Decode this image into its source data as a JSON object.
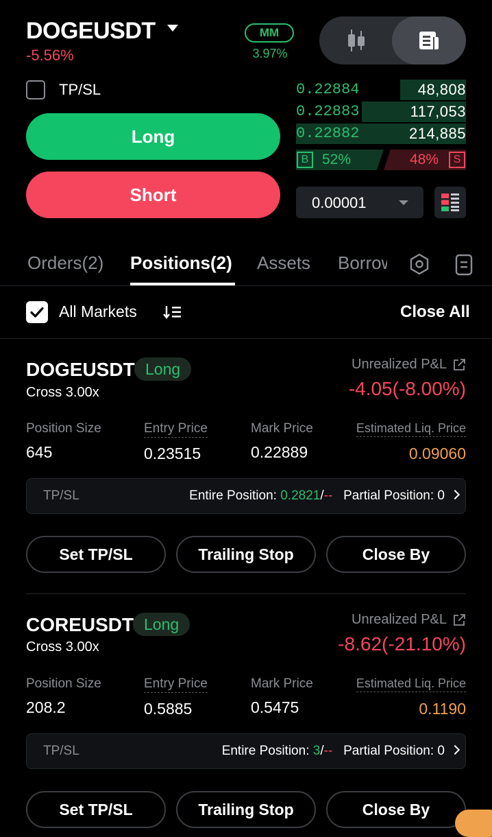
{
  "header": {
    "pair": "DOGEUSDT",
    "change_pct": "-5.56%",
    "mm_label": "MM",
    "mm_value": "3.97%"
  },
  "order_form": {
    "tpsl_label": "TP/SL",
    "long_label": "Long",
    "short_label": "Short"
  },
  "order_book": {
    "rows": [
      {
        "price": "0.22884",
        "qty": "48,808"
      },
      {
        "price": "0.22883",
        "qty": "117,053"
      },
      {
        "price": "0.22882",
        "qty": "214,885"
      }
    ],
    "buy_tag": "B",
    "buy_pct": "52%",
    "sell_pct": "48%",
    "sell_tag": "S",
    "tick_size": "0.00001"
  },
  "tabs": [
    {
      "label": "Orders(2)"
    },
    {
      "label": "Positions(2)"
    },
    {
      "label": "Assets"
    },
    {
      "label": "Borrow"
    }
  ],
  "filter": {
    "all_markets": "All Markets",
    "close_all": "Close All"
  },
  "labels": {
    "unrealized_pnl": "Unrealized P&L",
    "position_size": "Position Size",
    "entry_price": "Entry Price",
    "mark_price": "Mark Price",
    "est_liq_price": "Estimated Liq. Price",
    "tpsl": "TP/SL",
    "entire_position": "Entire Position:",
    "partial_position": "Partial Position:",
    "set_tpsl": "Set TP/SL",
    "trailing_stop": "Trailing Stop",
    "close_by": "Close By",
    "slash": "/",
    "dashes": "--"
  },
  "positions": [
    {
      "symbol": "DOGEUSDT",
      "side": "Long",
      "margin_mode": "Cross 3.00x",
      "pnl": "-4.05(-8.00%)",
      "size": "645",
      "entry": "0.23515",
      "mark": "0.22889",
      "liq": "0.09060",
      "tp": "0.2821",
      "partial_count": "0"
    },
    {
      "symbol": "COREUSDT",
      "side": "Long",
      "margin_mode": "Cross 3.00x",
      "pnl": "-8.62(-21.10%)",
      "size": "208.2",
      "entry": "0.5885",
      "mark": "0.5475",
      "liq": "0.1190",
      "tp": "3",
      "partial_count": "0"
    }
  ],
  "colors": {
    "green": "#2ebd6f",
    "red": "#f6465d",
    "orange": "#f0a14b",
    "background": "#000000"
  }
}
